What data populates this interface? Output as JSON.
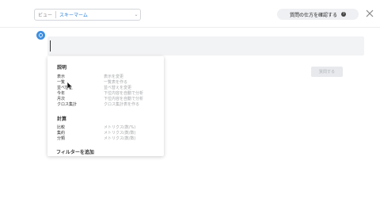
{
  "header": {
    "view_label": "ビュー",
    "view_value": "スキーマーム",
    "help_label": "質問の仕方を確認する",
    "help_icon_glyph": "?"
  },
  "query": {
    "value": ""
  },
  "run_button": {
    "label": "質問する"
  },
  "dropdown": {
    "sections": [
      {
        "title": "説明",
        "items": [
          {
            "name": "表示",
            "desc": "表示を変更"
          },
          {
            "name": "一覧",
            "desc": "一覧表を作る"
          },
          {
            "name": "並べ替え",
            "desc": "並べ替えを変更"
          },
          {
            "name": "今年",
            "desc": "下位内容を自動で分析"
          },
          {
            "name": "月次",
            "desc": "下位内容を自動で分析"
          },
          {
            "name": "クロス集計",
            "desc": "クロス集計表を作る"
          }
        ]
      },
      {
        "title": "計算",
        "items": [
          {
            "name": "比較",
            "desc": "メトリクス(数/%)"
          },
          {
            "name": "集約",
            "desc": "メトリクス(数/数)"
          },
          {
            "name": "分類",
            "desc": "メトリクス(数/数)"
          }
        ]
      }
    ],
    "add_filter_label": "フィルターを追加"
  },
  "colors": {
    "accent": "#3d8fe0",
    "link": "#2a7fd4",
    "muted": "#a6a8ab"
  }
}
